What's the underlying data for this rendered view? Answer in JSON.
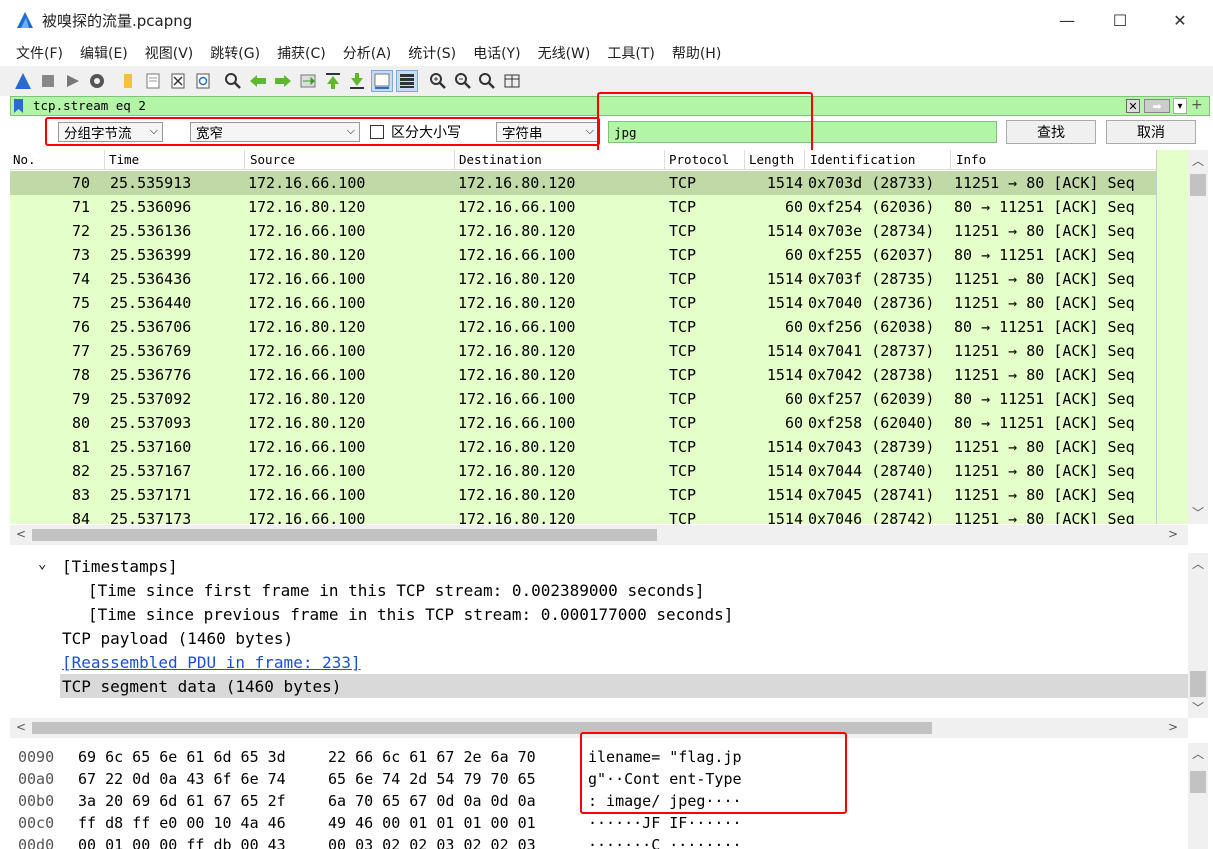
{
  "window": {
    "title": "被嗅探的流量.pcapng",
    "minimize": "—",
    "maximize": "☐",
    "close": "✕"
  },
  "menu": [
    "文件(F)",
    "编辑(E)",
    "视图(V)",
    "跳转(G)",
    "捕获(C)",
    "分析(A)",
    "统计(S)",
    "电话(Y)",
    "无线(W)",
    "工具(T)",
    "帮助(H)"
  ],
  "display_filter": {
    "value": "tcp.stream eq 2",
    "clear": "✕",
    "apply": "➡",
    "dropdown": "▾",
    "add": "+"
  },
  "find_bar": {
    "search_in": "分组字节流",
    "charset": "宽窄",
    "case_sensitive_label": "区分大小写",
    "search_type": "字符串",
    "search_value": "jpg",
    "find_button": "查找",
    "cancel_button": "取消",
    "dropdown_arrow": "⌵"
  },
  "packet_list": {
    "columns": [
      "No.",
      "Time",
      "Source",
      "Destination",
      "Protocol",
      "Length",
      "Identification",
      "Info"
    ],
    "rows": [
      {
        "no": "70",
        "time": "25.535913",
        "src": "172.16.66.100",
        "dst": "172.16.80.120",
        "proto": "TCP",
        "len": "1514",
        "ident": "0x703d (28733)",
        "info": "11251 → 80 [ACK] Seq"
      },
      {
        "no": "71",
        "time": "25.536096",
        "src": "172.16.80.120",
        "dst": "172.16.66.100",
        "proto": "TCP",
        "len": "60",
        "ident": "0xf254 (62036)",
        "info": "80 → 11251 [ACK] Seq"
      },
      {
        "no": "72",
        "time": "25.536136",
        "src": "172.16.66.100",
        "dst": "172.16.80.120",
        "proto": "TCP",
        "len": "1514",
        "ident": "0x703e (28734)",
        "info": "11251 → 80 [ACK] Seq"
      },
      {
        "no": "73",
        "time": "25.536399",
        "src": "172.16.80.120",
        "dst": "172.16.66.100",
        "proto": "TCP",
        "len": "60",
        "ident": "0xf255 (62037)",
        "info": "80 → 11251 [ACK] Seq"
      },
      {
        "no": "74",
        "time": "25.536436",
        "src": "172.16.66.100",
        "dst": "172.16.80.120",
        "proto": "TCP",
        "len": "1514",
        "ident": "0x703f (28735)",
        "info": "11251 → 80 [ACK] Seq"
      },
      {
        "no": "75",
        "time": "25.536440",
        "src": "172.16.66.100",
        "dst": "172.16.80.120",
        "proto": "TCP",
        "len": "1514",
        "ident": "0x7040 (28736)",
        "info": "11251 → 80 [ACK] Seq"
      },
      {
        "no": "76",
        "time": "25.536706",
        "src": "172.16.80.120",
        "dst": "172.16.66.100",
        "proto": "TCP",
        "len": "60",
        "ident": "0xf256 (62038)",
        "info": "80 → 11251 [ACK] Seq"
      },
      {
        "no": "77",
        "time": "25.536769",
        "src": "172.16.66.100",
        "dst": "172.16.80.120",
        "proto": "TCP",
        "len": "1514",
        "ident": "0x7041 (28737)",
        "info": "11251 → 80 [ACK] Seq"
      },
      {
        "no": "78",
        "time": "25.536776",
        "src": "172.16.66.100",
        "dst": "172.16.80.120",
        "proto": "TCP",
        "len": "1514",
        "ident": "0x7042 (28738)",
        "info": "11251 → 80 [ACK] Seq"
      },
      {
        "no": "79",
        "time": "25.537092",
        "src": "172.16.80.120",
        "dst": "172.16.66.100",
        "proto": "TCP",
        "len": "60",
        "ident": "0xf257 (62039)",
        "info": "80 → 11251 [ACK] Seq"
      },
      {
        "no": "80",
        "time": "25.537093",
        "src": "172.16.80.120",
        "dst": "172.16.66.100",
        "proto": "TCP",
        "len": "60",
        "ident": "0xf258 (62040)",
        "info": "80 → 11251 [ACK] Seq"
      },
      {
        "no": "81",
        "time": "25.537160",
        "src": "172.16.66.100",
        "dst": "172.16.80.120",
        "proto": "TCP",
        "len": "1514",
        "ident": "0x7043 (28739)",
        "info": "11251 → 80 [ACK] Seq"
      },
      {
        "no": "82",
        "time": "25.537167",
        "src": "172.16.66.100",
        "dst": "172.16.80.120",
        "proto": "TCP",
        "len": "1514",
        "ident": "0x7044 (28740)",
        "info": "11251 → 80 [ACK] Seq"
      },
      {
        "no": "83",
        "time": "25.537171",
        "src": "172.16.66.100",
        "dst": "172.16.80.120",
        "proto": "TCP",
        "len": "1514",
        "ident": "0x7045 (28741)",
        "info": "11251 → 80 [ACK] Seq"
      },
      {
        "no": "84",
        "time": "25.537173",
        "src": "172.16.66.100",
        "dst": "172.16.80.120",
        "proto": "TCP",
        "len": "1514",
        "ident": "0x7046 (28742)",
        "info": "11251 → 80 [ACK] Seq"
      }
    ]
  },
  "details": {
    "timestamps_arrow": "⌄",
    "timestamps": "[Timestamps]",
    "since_first": "[Time since first frame in this TCP stream: 0.002389000 seconds]",
    "since_prev": "[Time since previous frame in this TCP stream: 0.000177000 seconds]",
    "payload": "TCP payload (1460 bytes)",
    "reassembled": "[Reassembled PDU in frame: 233]",
    "segment": "TCP segment data (1460 bytes)"
  },
  "hex_dump": [
    {
      "offset": "0090",
      "hex1": "69 6c 65 6e 61 6d 65 3d",
      "hex2": "22 66 6c 61 67 2e 6a 70",
      "ascii": "ilename= \"flag.jp"
    },
    {
      "offset": "00a0",
      "hex1": "67 22 0d 0a 43 6f 6e 74",
      "hex2": "65 6e 74 2d 54 79 70 65",
      "ascii": "g\"··Cont ent-Type"
    },
    {
      "offset": "00b0",
      "hex1": "3a 20 69 6d 61 67 65 2f",
      "hex2": "6a 70 65 67 0d 0a 0d 0a",
      "ascii": ": image/ jpeg····"
    },
    {
      "offset": "00c0",
      "hex1": "ff d8 ff e0 00 10 4a 46",
      "hex2": "49 46 00 01 01 01 00 01",
      "ascii": "······JF IF······"
    },
    {
      "offset": "00d0",
      "hex1": "00 01 00 00 ff db 00 43",
      "hex2": "00 03 02 02 03 02 02 03",
      "ascii": "·······C ········"
    }
  ],
  "scroll": {
    "left": "<",
    "right": ">",
    "up": "︿",
    "down": "﹀"
  },
  "colors": {
    "row_bg": "#e4ffc7",
    "selected_row": "#c0d9a6",
    "filter_bg": "#b3f5a6",
    "highlight": "#ff0000"
  },
  "icons": [
    "shark-fin-icon",
    "stop-icon",
    "restart-icon",
    "options-icon",
    "open-icon",
    "file-icon",
    "close-file-icon",
    "reload-icon",
    "find-icon",
    "back-icon",
    "forward-icon",
    "goto-icon",
    "first-icon",
    "last-icon",
    "autoscroll-icon",
    "colorize-icon",
    "zoom-in-icon",
    "zoom-out-icon",
    "zoom-normal-icon",
    "resize-columns-icon"
  ]
}
